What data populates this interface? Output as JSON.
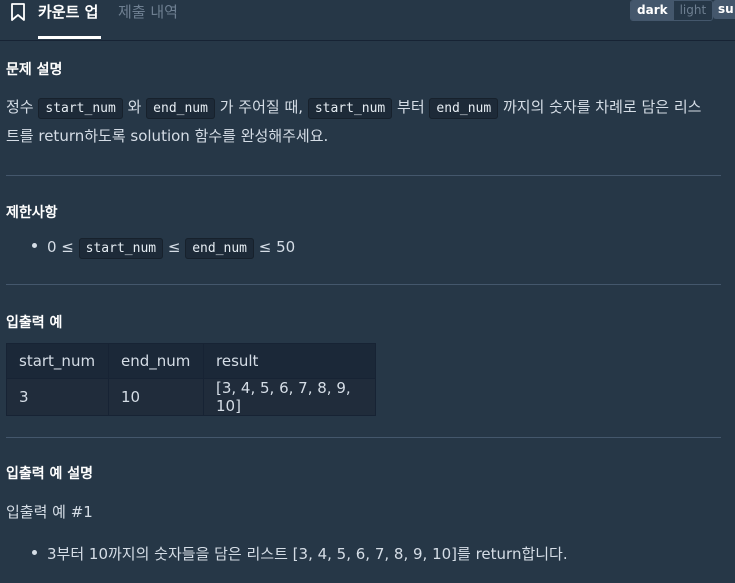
{
  "tabs": {
    "active": "카운트 업",
    "submissions": "제출 내역"
  },
  "theme": {
    "dark": "dark",
    "light": "light",
    "su": "su"
  },
  "problem": {
    "title": "문제 설명",
    "p1_a": "정수 ",
    "code_start": "start_num",
    "p1_b": " 와 ",
    "code_end": "end_num",
    "p1_c": " 가 주어질 때, ",
    "p1_d": " 부터 ",
    "p1_e": " 까지의 숫자를 차례로 담은 리스",
    "p2": "트를 return하도록 solution 함수를 완성해주세요."
  },
  "constraints": {
    "title": "제한사항",
    "c1_a": "0 ≤ ",
    "c1_b": " ≤ ",
    "c1_c": " ≤ 50"
  },
  "io": {
    "title": "입출력 예",
    "headers": [
      "start_num",
      "end_num",
      "result"
    ],
    "rows": [
      [
        "3",
        "10",
        "[3, 4, 5, 6, 7, 8, 9, 10]"
      ]
    ]
  },
  "explanation": {
    "title": "입출력 예 설명",
    "example": "입출력 예 #1",
    "item1": "3부터 10까지의 숫자들을 담은 리스트 [3, 4, 5, 6, 7, 8, 9, 10]를 return합니다."
  }
}
